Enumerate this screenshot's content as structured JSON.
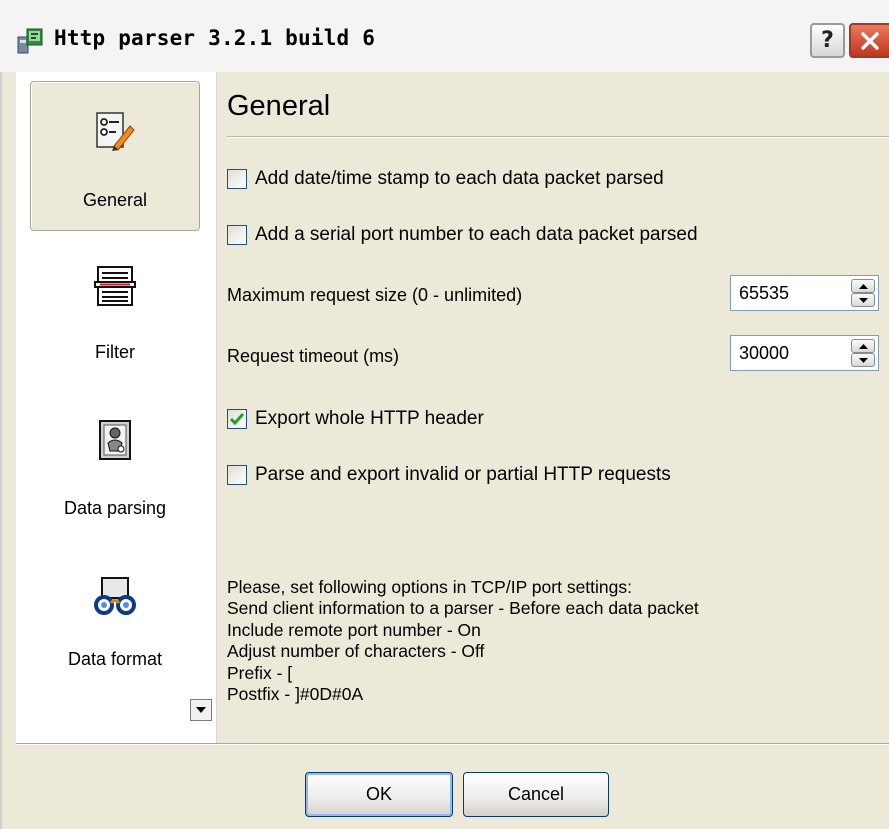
{
  "window": {
    "title": "Http parser 3.2.1 build 6",
    "help_label": "?"
  },
  "sidebar": {
    "items": [
      {
        "label": "General",
        "icon": "settings-edit-icon",
        "selected": true
      },
      {
        "label": "Filter",
        "icon": "filter-icon",
        "selected": false
      },
      {
        "label": "Data parsing",
        "icon": "data-parsing-icon",
        "selected": false
      },
      {
        "label": "Data format",
        "icon": "data-format-icon",
        "selected": false
      }
    ]
  },
  "main": {
    "title": "General",
    "options": {
      "timestamp": {
        "label": "Add date/time stamp to each data packet parsed",
        "checked": false
      },
      "port_number": {
        "label": "Add a serial port number to each data packet parsed",
        "checked": false
      },
      "export_header": {
        "label": "Export whole HTTP header",
        "checked": true
      },
      "parse_invalid": {
        "label": "Parse and export invalid or partial HTTP requests",
        "checked": false
      }
    },
    "max_request": {
      "label": "Maximum request size (0 - unlimited)",
      "value": "65535"
    },
    "timeout": {
      "label": "Request timeout (ms)",
      "value": "30000"
    },
    "info_lines": [
      "Please, set following options in TCP/IP port settings:",
      "Send client information to a parser - Before each data packet",
      "Include remote port number - On",
      "Adjust number of characters - Off",
      "Prefix - [",
      "Postfix - ]#0D#0A"
    ]
  },
  "buttons": {
    "ok": "OK",
    "cancel": "Cancel"
  },
  "colors": {
    "accent_check": "#21a121",
    "close_button": "#c2361b",
    "border_blue": "#003c74"
  }
}
